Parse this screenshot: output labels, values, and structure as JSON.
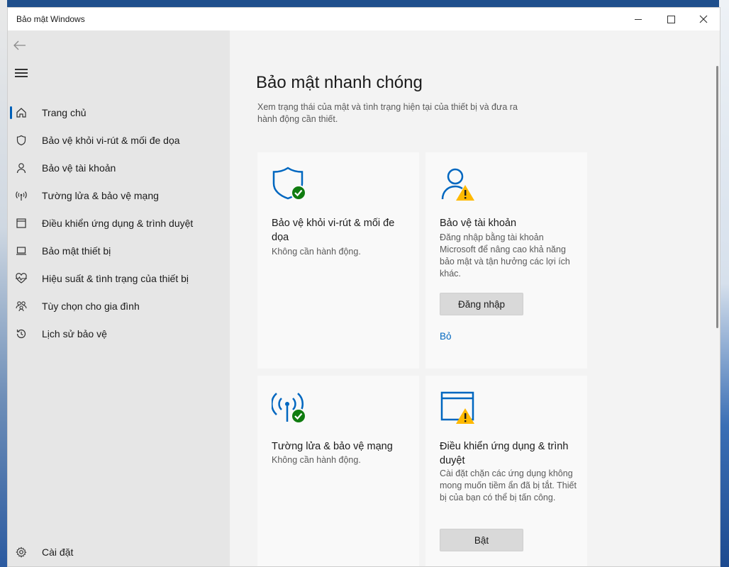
{
  "window": {
    "title": "Bảo mật Windows"
  },
  "sidebar": {
    "items": [
      {
        "label": "Trang chủ",
        "icon": "home-icon"
      },
      {
        "label": "Bảo vệ khỏi vi-rút & mối đe dọa",
        "icon": "shield-icon"
      },
      {
        "label": "Bảo vệ tài khoản",
        "icon": "person-icon"
      },
      {
        "label": "Tường lửa & bảo vệ mạng",
        "icon": "antenna-icon"
      },
      {
        "label": "Điều khiển ứng dụng & trình duyệt",
        "icon": "browser-window-icon"
      },
      {
        "label": "Bảo mật thiết bị",
        "icon": "laptop-icon"
      },
      {
        "label": "Hiệu suất & tình trạng của thiết bị",
        "icon": "heart-pulse-icon"
      },
      {
        "label": "Tùy chọn cho gia đình",
        "icon": "family-icon"
      },
      {
        "label": "Lịch sử bảo vệ",
        "icon": "history-icon"
      }
    ],
    "settings_label": "Cài đặt"
  },
  "main": {
    "title": "Bảo mật nhanh chóng",
    "description": "Xem trạng thái của mật và tình trạng hiện tại của thiết bị và đưa ra hành động cần thiết.",
    "cards": [
      {
        "title": "Bảo vệ khỏi vi-rút & mối đe dọa",
        "status": "Không cần hành động."
      },
      {
        "title": "Bảo vệ tài khoản",
        "status": "Đăng nhập bằng tài khoản Microsoft để nâng cao khả năng bảo mật và tận hưởng các lợi ích khác.",
        "button": "Đăng nhập",
        "link": "Bỏ"
      },
      {
        "title": "Tường lửa & bảo vệ mạng",
        "status": "Không cần hành động."
      },
      {
        "title": "Điều khiển ứng dụng & trình duyệt",
        "status": "Cài đặt chặn các ứng dụng không mong muốn tiềm ẩn đã bị tắt. Thiết bị của bạn có thể bị tấn công.",
        "button": "Bật"
      }
    ]
  },
  "colors": {
    "accent": "#0067c0",
    "ok": "#107c10",
    "warning": "#ffb900"
  }
}
